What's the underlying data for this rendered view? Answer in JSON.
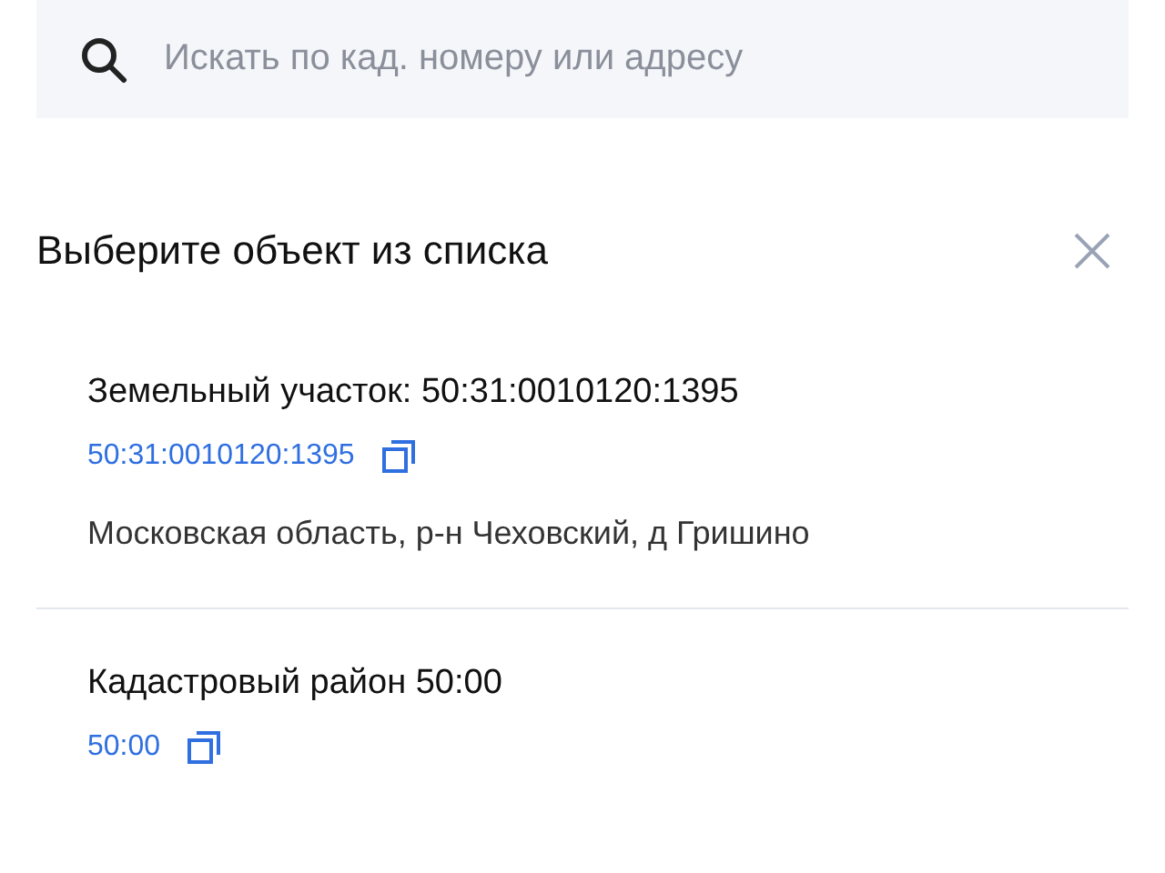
{
  "search": {
    "placeholder": "Искать по кад. номеру или адресу"
  },
  "panel": {
    "title": "Выберите объект из списка"
  },
  "items": [
    {
      "title": "Земельный участок: 50:31:0010120:1395",
      "number": "50:31:0010120:1395",
      "address": "Московская область, р-н Чеховский, д Гришино"
    },
    {
      "title": "Кадастровый район 50:00",
      "number": "50:00"
    }
  ]
}
